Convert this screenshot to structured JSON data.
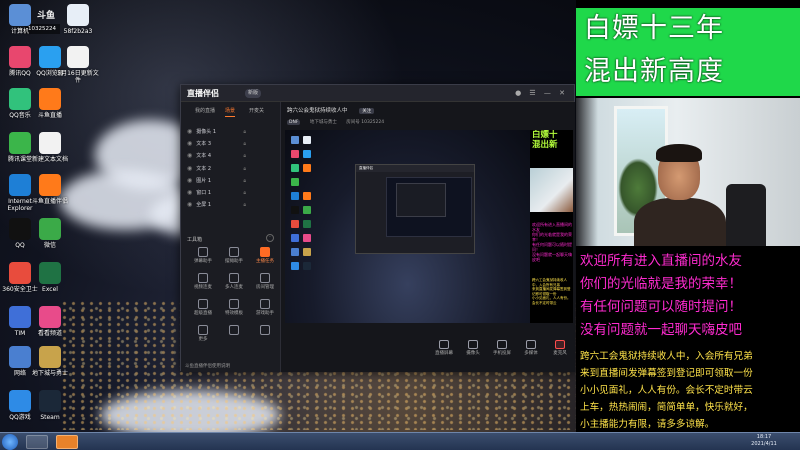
{
  "overlay": {
    "title_line1": "白嫖十三年",
    "title_line2": "混出新高度",
    "welcome_lines": [
      "欢迎所有进入直播间的水友",
      "你们的光临就是我的荣幸！",
      "有任何问题可以随时提问！",
      "没有问题就一起聊天嗨皮吧"
    ],
    "notice_lines": [
      "跨六工会鬼狱持续收人中，入会所有兄弟",
      "来到直播间发弹幕签到登记即可领取一份",
      "小小见面礼，人人有份。会长不定时带云",
      "上车，热热闹闹，简简单单，快乐就好，",
      "小主播能力有限，请多多谅解。"
    ]
  },
  "stream": {
    "logo": "斗鱼",
    "room_id": "10325224"
  },
  "desktop": {
    "icons": [
      {
        "label": "计算机",
        "icon": "computer-icon",
        "color": "#5b8fd6"
      },
      {
        "label": "58f2b2a3",
        "icon": "file-icon",
        "color": "#e7eef7"
      },
      {
        "label": "腾讯QQ",
        "icon": "qq-icon",
        "color": "#e8476e"
      },
      {
        "label": "QQ浏览器",
        "icon": "browser-icon",
        "color": "#2aa0f0"
      },
      {
        "label": "5月16日更新文件",
        "icon": "document-icon",
        "color": "#f2f2f2"
      },
      {
        "label": "QQ音乐",
        "icon": "music-icon",
        "color": "#31c27c"
      },
      {
        "label": "斗鱼直播",
        "icon": "douyu-icon",
        "color": "#ff7a1a"
      },
      {
        "label": "腾讯课堂",
        "icon": "classroom-icon",
        "color": "#3bb54a"
      },
      {
        "label": "新建文本文档",
        "icon": "text-file-icon",
        "color": "#f2f2f2"
      },
      {
        "label": "Internet Explorer",
        "icon": "ie-icon",
        "color": "#1e7fd6"
      },
      {
        "label": "斗鱼直播伴侣",
        "icon": "stream-companion-icon",
        "color": "#ff7a1a"
      },
      {
        "label": "QQ",
        "icon": "qq-penguin-icon",
        "color": "#111111"
      },
      {
        "label": "微信",
        "icon": "wechat-icon",
        "color": "#3baa48"
      },
      {
        "label": "360安全卫士",
        "icon": "security-icon",
        "color": "#e84c3d"
      },
      {
        "label": "Excel",
        "icon": "excel-icon",
        "color": "#1f7244"
      },
      {
        "label": "TIM",
        "icon": "tim-icon",
        "color": "#3f6fd8"
      },
      {
        "label": "看看频道",
        "icon": "video-icon",
        "color": "#e84b8a"
      },
      {
        "label": "网络",
        "icon": "network-icon",
        "color": "#4a7fd0"
      },
      {
        "label": "地下城与勇士",
        "icon": "game-icon",
        "color": "#c8a34b"
      },
      {
        "label": "QQ游戏",
        "icon": "qq-game-icon",
        "color": "#2e8be6"
      },
      {
        "label": "Steam",
        "icon": "steam-icon",
        "color": "#1b2838"
      }
    ]
  },
  "app": {
    "logo": "直播伴侣",
    "badge": "新版",
    "tabs": [
      "我的直播",
      "场景",
      "开麦关"
    ],
    "scenes": [
      "摄像头 1",
      "文本 3",
      "文本 4",
      "文本 2",
      "图片 1",
      "窗口 1",
      "全屏 1"
    ],
    "tools_title": "工具箱",
    "tools": [
      {
        "label": "弹幕助手",
        "icon": "danmaku-icon",
        "hot": false
      },
      {
        "label": "摆摊助手",
        "icon": "stall-icon",
        "hot": false
      },
      {
        "label": "主播任务",
        "icon": "task-icon",
        "hot": true
      },
      {
        "label": "视频连麦",
        "icon": "video-link-icon",
        "hot": false
      },
      {
        "label": "多人连麦",
        "icon": "multi-link-icon",
        "hot": false
      },
      {
        "label": "房间管理",
        "icon": "room-icon",
        "hot": false
      },
      {
        "label": "超级直播",
        "icon": "super-icon",
        "hot": false
      },
      {
        "label": "特效模板",
        "icon": "effect-icon",
        "hot": false
      },
      {
        "label": "游戏助手",
        "icon": "game-helper-icon",
        "hot": false
      },
      {
        "label": "更多",
        "icon": "more-icon",
        "hot": false
      },
      {
        "label": "",
        "icon": "gift-icon",
        "hot": false
      },
      {
        "label": "",
        "icon": "up-icon",
        "hot": false
      }
    ],
    "left_footer": "斗鱼直播伴侣使用说明",
    "room_title": "跨六公会鬼狱持续收人中",
    "close_tag": "关注",
    "room_tag": "DNF",
    "room_category": "地下城与勇士",
    "room_id_label": "房间号 10325224",
    "preview_title_line1": "白嫖十",
    "preview_title_line2": "混出新",
    "source_buttons": [
      {
        "label": "直播屏幕",
        "icon": "screen-icon"
      },
      {
        "label": "摄像头",
        "icon": "camera-icon"
      },
      {
        "label": "手机投屏",
        "icon": "phone-cast-icon"
      },
      {
        "label": "多媒体",
        "icon": "media-icon"
      },
      {
        "label": "麦克风",
        "icon": "mic-icon"
      },
      {
        "label": "扬声器",
        "icon": "speaker-icon"
      }
    ]
  },
  "taskbar": {
    "clock_time": "18:17",
    "clock_date": "2021/4/11"
  }
}
